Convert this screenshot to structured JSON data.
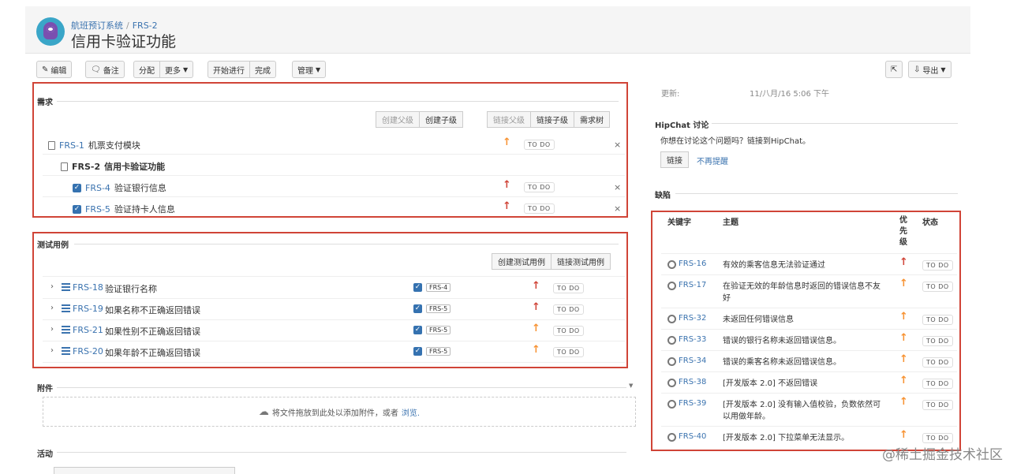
{
  "header": {
    "project": "航班预订系统",
    "issue_key": "FRS-2",
    "separator": "/",
    "title": "信用卡验证功能"
  },
  "toolbar": {
    "edit": "编辑",
    "comment": "备注",
    "assign": "分配",
    "more": "更多",
    "start": "开始进行",
    "done": "完成",
    "manage": "管理",
    "export": "导出"
  },
  "requirements": {
    "title": "需求",
    "buttons": {
      "create_parent": "创建父级",
      "create_child": "创建子级",
      "link_parent": "链接父级",
      "link_child": "链接子级",
      "tree": "需求树"
    },
    "rows": [
      {
        "key": "FRS-1",
        "summary": "机票支付模块",
        "status": "TO DO"
      },
      {
        "key": "FRS-2",
        "summary": "信用卡验证功能"
      },
      {
        "key": "FRS-4",
        "summary": "验证银行信息",
        "status": "TO DO"
      },
      {
        "key": "FRS-5",
        "summary": "验证持卡人信息",
        "status": "TO DO"
      }
    ],
    "remove": "×",
    "priority_up": "↑"
  },
  "tests": {
    "title": "测试用例",
    "create": "创建测试用例",
    "link": "链接测试用例",
    "rows": [
      {
        "key": "FRS-18",
        "summary": "验证银行名称",
        "req": "FRS-4",
        "status": "TO DO"
      },
      {
        "key": "FRS-19",
        "summary": "如果名称不正确返回错误",
        "req": "FRS-5",
        "status": "TO DO"
      },
      {
        "key": "FRS-21",
        "summary": "如果性别不正确返回错误",
        "req": "FRS-5",
        "status": "TO DO"
      },
      {
        "key": "FRS-20",
        "summary": "如果年龄不正确返回错误",
        "req": "FRS-5",
        "status": "TO DO"
      }
    ]
  },
  "attachments": {
    "title": "附件",
    "drop_text": "将文件拖放到此处以添加附件，或者",
    "browse": "浏览."
  },
  "activity": {
    "title": "活动"
  },
  "right": {
    "updated_label": "更新:",
    "updated_value": "11/八月/16 5:06 下午",
    "hipchat_title": "HipChat 讨论",
    "hipchat_text": "你想在讨论这个问题吗？链接到HipChat。",
    "link_btn": "链接",
    "dismiss": "不再提醒",
    "defects_title": "缺陷",
    "col_key": "关键字",
    "col_summary": "主题",
    "col_priority": "优先级",
    "col_status": "状态",
    "defects": [
      {
        "key": "FRS-16",
        "summary": "有效的乘客信息无法验证通过",
        "status": "TO DO"
      },
      {
        "key": "FRS-17",
        "summary": "在验证无效的年龄信息时返回的错误信息不友好",
        "status": "TO DO"
      },
      {
        "key": "FRS-32",
        "summary": "未返回任何错误信息",
        "status": "TO DO"
      },
      {
        "key": "FRS-33",
        "summary": "错误的银行名称未返回错误信息。",
        "status": "TO DO"
      },
      {
        "key": "FRS-34",
        "summary": "错误的乘客名称未返回错误信息。",
        "status": "TO DO"
      },
      {
        "key": "FRS-38",
        "summary": "[开发版本 2.0] 不返回错误",
        "status": "TO DO"
      },
      {
        "key": "FRS-39",
        "summary": "[开发版本 2.0] 没有输入值校验，负数依然可以用做年龄。",
        "status": "TO DO"
      },
      {
        "key": "FRS-40",
        "summary": "[开发版本 2.0] 下拉菜单无法显示。",
        "status": "TO DO"
      }
    ]
  },
  "colors": {
    "link": "#3b73af",
    "highlight": "#d04437",
    "priority_high": "#d04437",
    "priority_mid": "#f79232"
  },
  "watermark": "@稀土掘金技术社区"
}
